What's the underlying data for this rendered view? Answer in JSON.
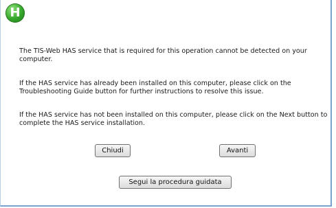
{
  "logo": {
    "letter": "H",
    "color": "#33a52a"
  },
  "messages": [
    "The TIS-Web HAS service that is required for this operation cannot be detected on your computer.",
    "If the HAS service has already been installed on this computer, please click on the Troubleshooting Guide button for further instructions to resolve this issue.",
    "If the HAS service has not been installed on this computer, please click on the Next button to complete the HAS service installation."
  ],
  "buttons": {
    "close_label": "Chiudi",
    "next_label": "Avanti",
    "guide_label": "Segui la procedura guidata"
  }
}
